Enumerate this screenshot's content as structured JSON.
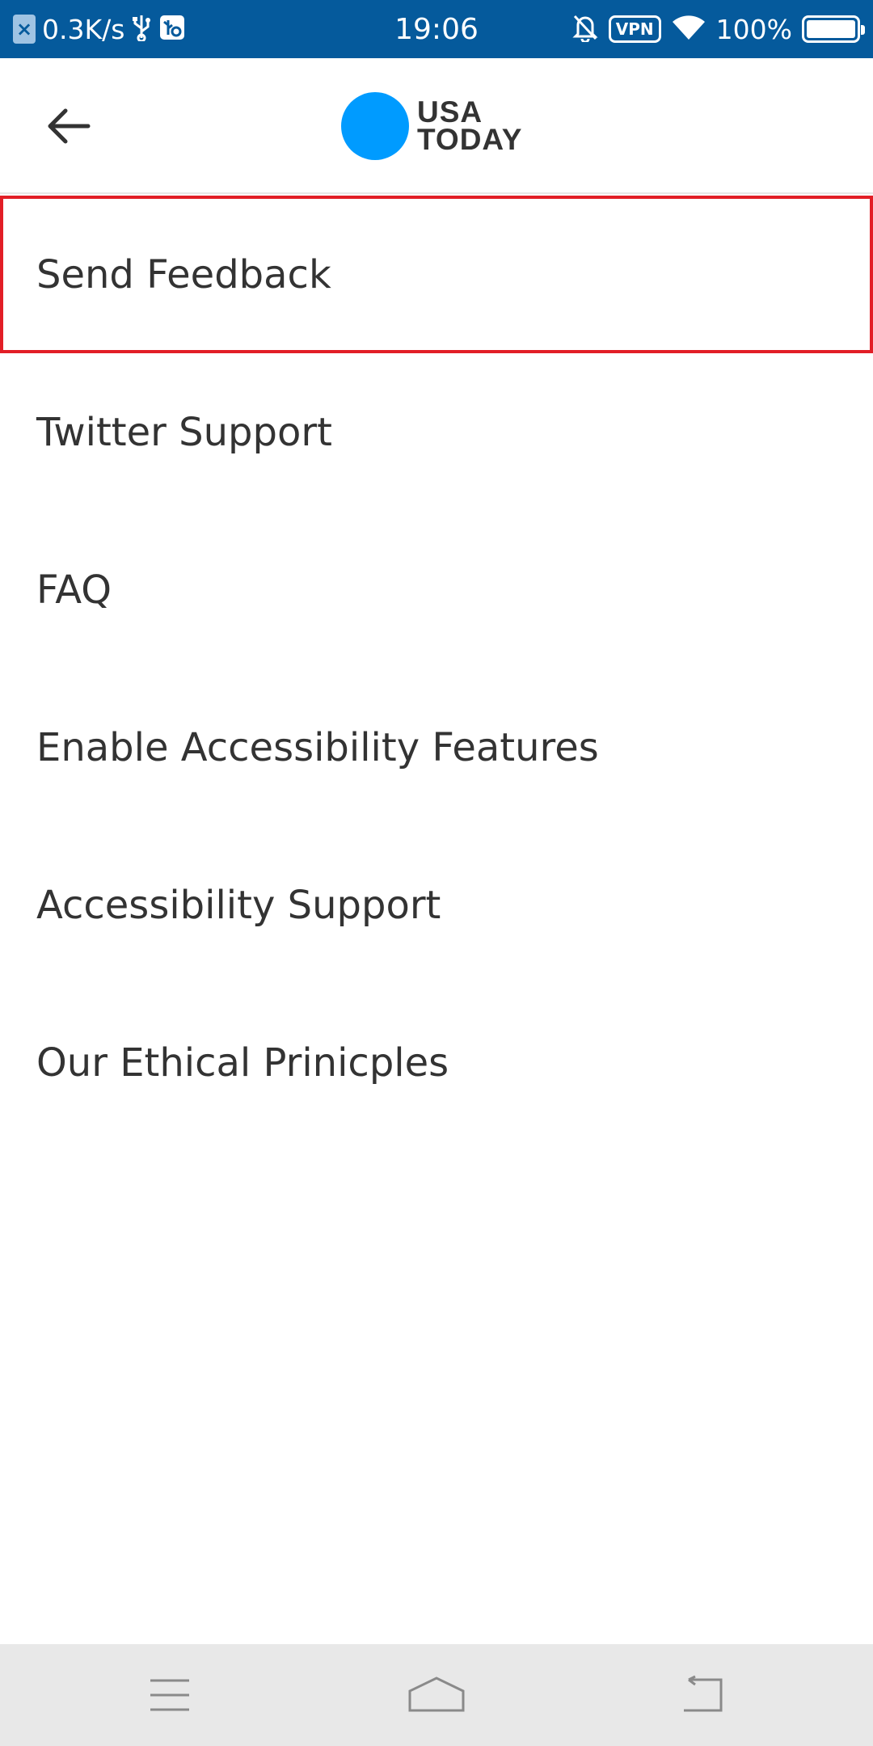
{
  "status_bar": {
    "net_speed": "0.3K/s",
    "time": "19:06",
    "vpn_label": "VPN",
    "battery_percent": "100%",
    "battery_level": 1.0,
    "icons": [
      "x-notification-icon",
      "usb-icon",
      "usb-debug-icon",
      "bell-off-icon",
      "vpn-icon",
      "wifi-icon",
      "battery-icon"
    ]
  },
  "app_bar": {
    "logo_line1": "USA",
    "logo_line2": "TODAY",
    "logo_color": "#009bff",
    "back_icon": "arrow-left-icon"
  },
  "menu": {
    "items": [
      {
        "label": "Send Feedback",
        "selected": true
      },
      {
        "label": "Twitter Support"
      },
      {
        "label": "FAQ"
      },
      {
        "label": "Enable Accessibility Features"
      },
      {
        "label": "Accessibility Support"
      },
      {
        "label": "Our Ethical Prinicples"
      }
    ]
  },
  "nav_bar": {
    "icons": [
      "menu-icon",
      "home-icon",
      "back-icon"
    ]
  },
  "colors": {
    "status_bar": "#055a9c",
    "highlight": "#e21e26",
    "text": "#333333"
  }
}
